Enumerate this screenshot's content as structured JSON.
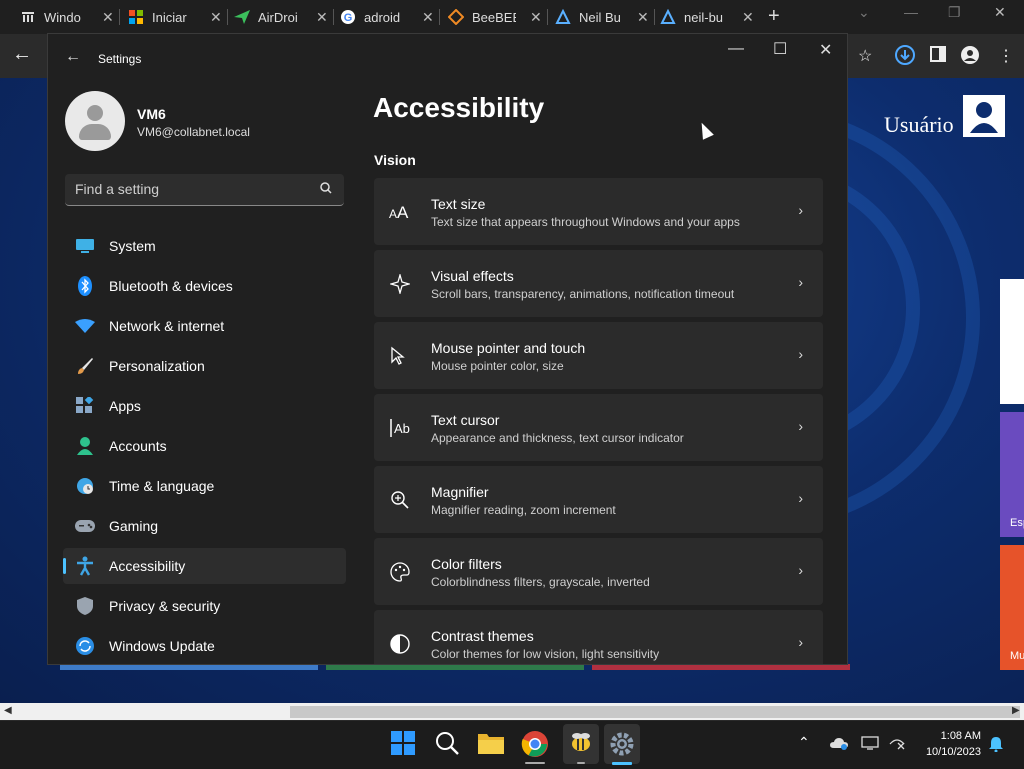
{
  "browser": {
    "tabs": [
      {
        "title": "Windo",
        "icon": "columns-icon"
      },
      {
        "title": "Iniciar",
        "icon": "windows-logo-icon"
      },
      {
        "title": "AirDroi",
        "icon": "airdroid-icon"
      },
      {
        "title": "adroid",
        "icon": "google-icon"
      },
      {
        "title": "BeeBEE",
        "icon": "beebee-icon"
      },
      {
        "title": "Neil Bu",
        "icon": "neil-icon"
      },
      {
        "title": "neil-bu",
        "icon": "neil-icon"
      }
    ],
    "page": {
      "user_label": "Usuário",
      "tile_labels": [
        "Esp",
        "Mu"
      ]
    }
  },
  "settings": {
    "window_title": "Settings",
    "user": {
      "name": "VM6",
      "email": "VM6@collabnet.local"
    },
    "search_placeholder": "Find a setting",
    "nav": [
      {
        "label": "System",
        "icon": "monitor-icon",
        "color": "#3fb1e6"
      },
      {
        "label": "Bluetooth & devices",
        "icon": "bluetooth-icon",
        "color": "#1e90ff"
      },
      {
        "label": "Network & internet",
        "icon": "wifi-icon",
        "color": "#3aa0ff"
      },
      {
        "label": "Personalization",
        "icon": "brush-icon",
        "color": "#e39a4a"
      },
      {
        "label": "Apps",
        "icon": "apps-icon",
        "color": "#8aa8c8"
      },
      {
        "label": "Accounts",
        "icon": "person-icon",
        "color": "#2ec28d"
      },
      {
        "label": "Time & language",
        "icon": "globe-clock-icon",
        "color": "#3fa6e6"
      },
      {
        "label": "Gaming",
        "icon": "controller-icon",
        "color": "#9aa4b0"
      },
      {
        "label": "Accessibility",
        "icon": "accessibility-icon",
        "color": "#3fa6e6",
        "selected": true
      },
      {
        "label": "Privacy & security",
        "icon": "shield-icon",
        "color": "#9aa4b0"
      },
      {
        "label": "Windows Update",
        "icon": "update-icon",
        "color": "#2a8ee6"
      }
    ],
    "page_title": "Accessibility",
    "section": "Vision",
    "cards": [
      {
        "title": "Text size",
        "subtitle": "Text size that appears throughout Windows and your apps",
        "icon": "text-size-icon"
      },
      {
        "title": "Visual effects",
        "subtitle": "Scroll bars, transparency, animations, notification timeout",
        "icon": "sparkle-icon"
      },
      {
        "title": "Mouse pointer and touch",
        "subtitle": "Mouse pointer color, size",
        "icon": "pointer-icon"
      },
      {
        "title": "Text cursor",
        "subtitle": "Appearance and thickness, text cursor indicator",
        "icon": "text-cursor-icon"
      },
      {
        "title": "Magnifier",
        "subtitle": "Magnifier reading, zoom increment",
        "icon": "magnifier-icon"
      },
      {
        "title": "Color filters",
        "subtitle": "Colorblindness filters, grayscale, inverted",
        "icon": "palette-icon"
      },
      {
        "title": "Contrast themes",
        "subtitle": "Color themes for low vision, light sensitivity",
        "icon": "contrast-icon"
      }
    ]
  },
  "taskbar": {
    "time": "1:08 AM",
    "date": "10/10/2023"
  }
}
